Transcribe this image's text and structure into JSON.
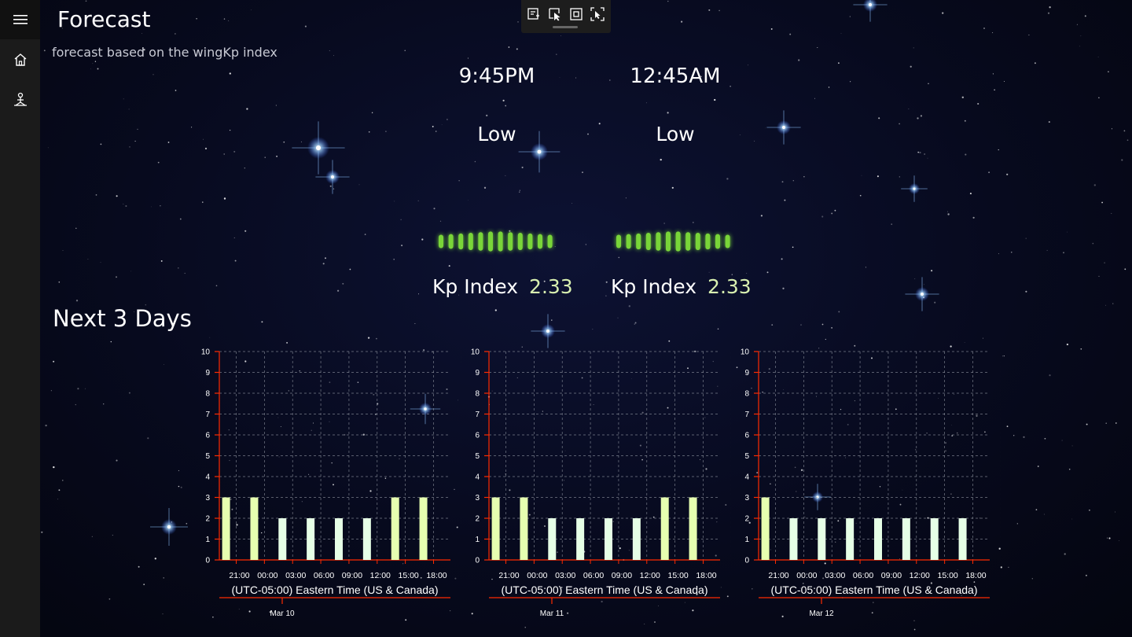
{
  "app": {
    "title": "Forecast",
    "subtitle": "forecast based on the wingKp index"
  },
  "nav": [
    {
      "icon": "home-icon"
    },
    {
      "icon": "person-location-icon"
    }
  ],
  "toolbar": {
    "icons": [
      "live-visual-tree-icon",
      "select-element-icon",
      "display-layout-adorners-icon",
      "track-focused-element-icon"
    ]
  },
  "forecasts": [
    {
      "time": "9:45PM",
      "level": "Low",
      "kp_label": "Kp Index",
      "kp_value": "2.33",
      "meter_level": 0.23
    },
    {
      "time": "12:45AM",
      "level": "Low",
      "kp_label": "Kp Index",
      "kp_value": "2.33",
      "meter_level": 0.23
    }
  ],
  "section_title": "Next 3 Days",
  "colors": {
    "bar_high": "#e6ffb0",
    "bar_low": "#e6ffe6",
    "axis": "#ff2a00",
    "meter": "#7fe03a"
  },
  "chart_data": [
    {
      "type": "bar",
      "categories": [
        "21:00",
        "00:00",
        "03:00",
        "06:00",
        "09:00",
        "12:00",
        "15:00",
        "18:00"
      ],
      "values": [
        3,
        3,
        2,
        2,
        2,
        2,
        3,
        3
      ],
      "yticks": [
        "0",
        "1",
        "2",
        "3",
        "4",
        "5",
        "6",
        "7",
        "8",
        "9",
        "10"
      ],
      "ylim": [
        0,
        10
      ],
      "xlabel": "(UTC-05:00) Eastern Time (US & Canada)",
      "date_label": "Mar 10",
      "grid": true
    },
    {
      "type": "bar",
      "categories": [
        "21:00",
        "00:00",
        "03:00",
        "06:00",
        "09:00",
        "12:00",
        "15:00",
        "18:00"
      ],
      "values": [
        3,
        3,
        2,
        2,
        2,
        2,
        3,
        3
      ],
      "yticks": [
        "0",
        "1",
        "2",
        "3",
        "4",
        "5",
        "6",
        "7",
        "8",
        "9",
        "10"
      ],
      "ylim": [
        0,
        10
      ],
      "xlabel": "(UTC-05:00) Eastern Time (US & Canada)",
      "date_label": "Mar 11",
      "grid": true
    },
    {
      "type": "bar",
      "categories": [
        "21:00",
        "00:00",
        "03:00",
        "06:00",
        "09:00",
        "12:00",
        "15:00",
        "18:00"
      ],
      "values": [
        3,
        2,
        2,
        2,
        2,
        2,
        2,
        2
      ],
      "yticks": [
        "0",
        "1",
        "2",
        "3",
        "4",
        "5",
        "6",
        "7",
        "8",
        "9",
        "10"
      ],
      "ylim": [
        0,
        10
      ],
      "xlabel": "(UTC-05:00) Eastern Time (US & Canada)",
      "date_label": "Mar 12",
      "grid": true
    }
  ]
}
